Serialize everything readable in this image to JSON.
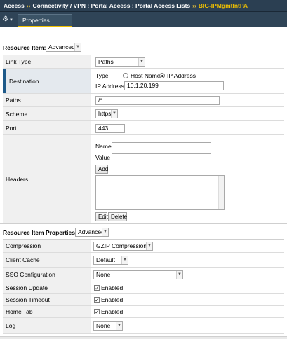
{
  "breadcrumb": {
    "items": [
      "Access",
      "Connectivity / VPN : Portal Access : Portal Access Lists"
    ],
    "separator": "››",
    "current": "BIG-IPMgmtIntPA"
  },
  "toolbar": {
    "gear_icon": "gear-icon",
    "tabs": [
      {
        "label": "Properties",
        "active": true
      }
    ]
  },
  "resource_item": {
    "heading": "Resource Item:",
    "mode_selected": "Advanced",
    "link_type": {
      "label": "Link Type",
      "selected": "Paths"
    },
    "destination": {
      "label": "Destination",
      "type_label": "Type:",
      "option_host": "Host Name",
      "option_ip": "IP Address",
      "selected": "IP Address",
      "ip_label": "IP Address",
      "ip_value": "10.1.20.199"
    },
    "paths": {
      "label": "Paths",
      "value": "/*"
    },
    "scheme": {
      "label": "Scheme",
      "selected": "https"
    },
    "port": {
      "label": "Port",
      "value": "443"
    },
    "headers": {
      "label": "Headers",
      "name_label": "Name",
      "value_label": "Value",
      "add_label": "Add",
      "edit_label": "Edit",
      "delete_label": "Delete"
    }
  },
  "resource_item_properties": {
    "heading": "Resource Item Properties:",
    "mode_selected": "Advanced",
    "compression": {
      "label": "Compression",
      "selected": "GZIP Compression"
    },
    "client_cache": {
      "label": "Client Cache",
      "selected": "Default"
    },
    "sso_configuration": {
      "label": "SSO Configuration",
      "selected": "None"
    },
    "session_update": {
      "label": "Session Update",
      "checked": true,
      "text": "Enabled"
    },
    "session_timeout": {
      "label": "Session Timeout",
      "checked": true,
      "text": "Enabled"
    },
    "home_tab": {
      "label": "Home Tab",
      "checked": true,
      "text": "Enabled"
    },
    "log": {
      "label": "Log",
      "selected": "None"
    }
  },
  "colors": {
    "titlebar_bg": "#2b3f52",
    "accent_yellow": "#f0c000",
    "active_marker": "#1e5a8a"
  }
}
